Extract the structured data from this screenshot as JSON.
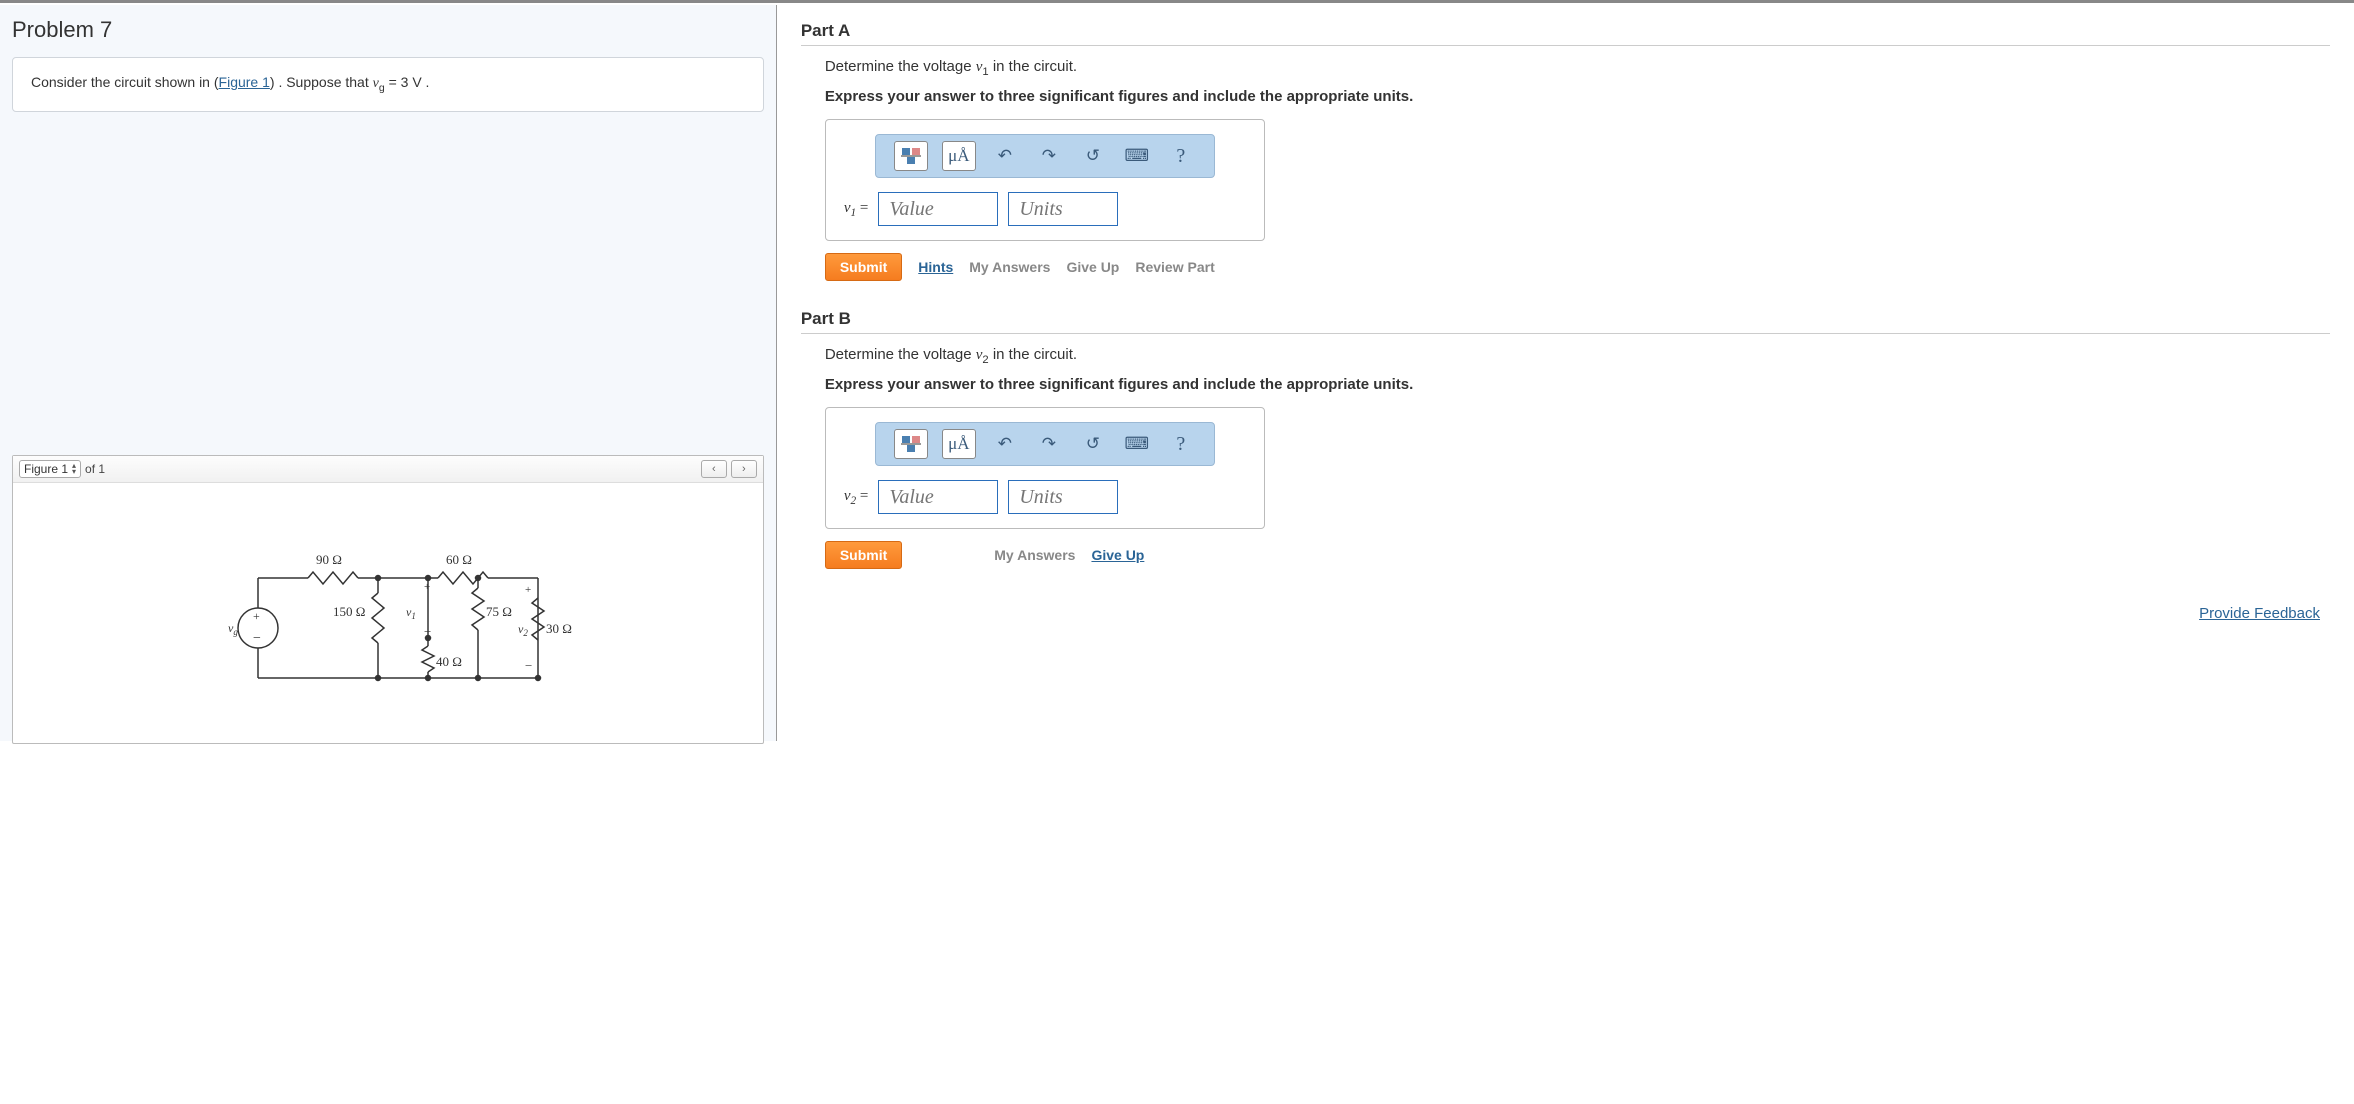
{
  "problem": {
    "title": "Problem 7",
    "prompt_prefix": "Consider the circuit shown in (",
    "figure_link": "Figure 1",
    "prompt_mid": ") . Suppose that ",
    "var": "v",
    "var_sub": "g",
    "prompt_suffix": " = 3 V ."
  },
  "figure": {
    "selector_label": "Figure 1",
    "of_text": "of 1",
    "circuit": {
      "r90": "90 Ω",
      "r60": "60 Ω",
      "r150": "150 Ω",
      "r75": "75 Ω",
      "r40": "40 Ω",
      "r30": "30 Ω",
      "vg": "vg",
      "v1": "v1",
      "v2": "v2"
    }
  },
  "partA": {
    "title": "Part A",
    "question_pre": "Determine the voltage ",
    "question_var": "v",
    "question_sub": "1",
    "question_post": " in the circuit.",
    "instruction": "Express your answer to three significant figures and include the appropriate units.",
    "label_var": "v",
    "label_sub": "1",
    "label_eq": " =",
    "value_placeholder": "Value",
    "units_placeholder": "Units",
    "submit": "Submit",
    "hints": "Hints",
    "myanswers": "My Answers",
    "giveup": "Give Up",
    "review": "Review Part",
    "units_tool": "μÅ"
  },
  "partB": {
    "title": "Part B",
    "question_pre": "Determine the voltage ",
    "question_var": "v",
    "question_sub": "2",
    "question_post": " in the circuit.",
    "instruction": "Express your answer to three significant figures and include the appropriate units.",
    "label_var": "v",
    "label_sub": "2",
    "label_eq": " =",
    "value_placeholder": "Value",
    "units_placeholder": "Units",
    "submit": "Submit",
    "myanswers": "My Answers",
    "giveup": "Give Up",
    "units_tool": "μÅ"
  },
  "feedback": "Provide Feedback",
  "icons": {
    "undo": "↶",
    "redo": "↷",
    "reset": "↺",
    "keyboard": "⌨",
    "help": "?",
    "prev": "‹",
    "next": "›",
    "up": "▴",
    "down": "▾"
  }
}
